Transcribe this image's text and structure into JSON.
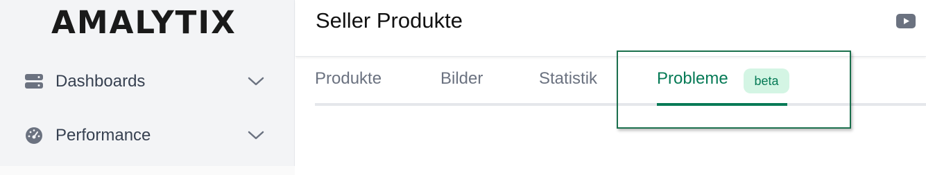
{
  "brand": {
    "logo_text": "AMALYTIX"
  },
  "sidebar": {
    "items": [
      {
        "label": "Dashboards",
        "icon": "server-icon"
      },
      {
        "label": "Performance",
        "icon": "gauge-icon"
      }
    ]
  },
  "header": {
    "title": "Seller Produkte",
    "video_icon": "youtube-icon"
  },
  "tabs": [
    {
      "label": "Produkte",
      "active": false
    },
    {
      "label": "Bilder",
      "active": false
    },
    {
      "label": "Statistik",
      "active": false
    },
    {
      "label": "Probleme",
      "active": true,
      "badge": "beta"
    }
  ],
  "colors": {
    "accent": "#067a56",
    "badge_bg": "#d4f5e4",
    "sidebar_bg": "#f3f4f6",
    "highlight_border": "#1a6f4c"
  }
}
